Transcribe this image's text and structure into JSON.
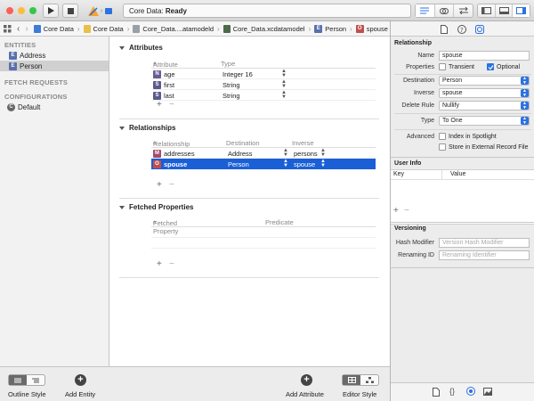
{
  "toolbar": {
    "status_prefix": "Core Data: ",
    "status_value": "Ready",
    "colors": {
      "close": "#fc605c",
      "minimize": "#fdbc40",
      "zoom": "#34c84a",
      "accent": "#1a5fd6"
    }
  },
  "jumpbar": {
    "crumbs": [
      "Core Data",
      "Core Data",
      "Core_Data....atamodeld",
      "Core_Data.xcdatamodel",
      "Person",
      "spouse"
    ]
  },
  "sidebar": {
    "entities_header": "ENTITIES",
    "entities": [
      {
        "badge": "E",
        "label": "Address"
      },
      {
        "badge": "E",
        "label": "Person"
      }
    ],
    "fetch_header": "FETCH REQUESTS",
    "config_header": "CONFIGURATIONS",
    "configs": [
      {
        "badge": "C",
        "label": "Default"
      }
    ]
  },
  "attributes": {
    "title": "Attributes",
    "col_attribute": "Attribute",
    "col_type": "Type",
    "rows": [
      {
        "badge": "N",
        "name": "age",
        "type": "Integer 16"
      },
      {
        "badge": "S",
        "name": "first",
        "type": "String"
      },
      {
        "badge": "S",
        "name": "last",
        "type": "String"
      }
    ]
  },
  "relationships": {
    "title": "Relationships",
    "col_relationship": "Relationship",
    "col_destination": "Destination",
    "col_inverse": "Inverse",
    "rows": [
      {
        "badge": "M",
        "name": "addresses",
        "destination": "Address",
        "inverse": "persons"
      },
      {
        "badge": "O",
        "name": "spouse",
        "destination": "Person",
        "inverse": "spouse"
      }
    ]
  },
  "fetched": {
    "title": "Fetched Properties",
    "col_fetched": "Fetched Property",
    "col_predicate": "Predicate"
  },
  "bottom": {
    "outline_style": "Outline Style",
    "add_entity": "Add Entity",
    "add_attribute": "Add Attribute",
    "editor_style": "Editor Style"
  },
  "inspector": {
    "relationship_header": "Relationship",
    "name_label": "Name",
    "name_value": "spouse",
    "properties_label": "Properties",
    "transient": "Transient",
    "optional": "Optional",
    "destination_label": "Destination",
    "destination_value": "Person",
    "inverse_label": "Inverse",
    "inverse_value": "spouse",
    "delete_rule_label": "Delete Rule",
    "delete_rule_value": "Nullify",
    "type_label": "Type",
    "type_value": "To One",
    "advanced_label": "Advanced",
    "index_spotlight": "Index in Spotlight",
    "store_external": "Store in External Record File",
    "userinfo_header": "User Info",
    "key_col": "Key",
    "value_col": "Value",
    "versioning_header": "Versioning",
    "hash_label": "Hash Modifier",
    "hash_placeholder": "Version Hash Modifier",
    "renaming_label": "Renaming ID",
    "renaming_placeholder": "Renaming Identifier"
  }
}
